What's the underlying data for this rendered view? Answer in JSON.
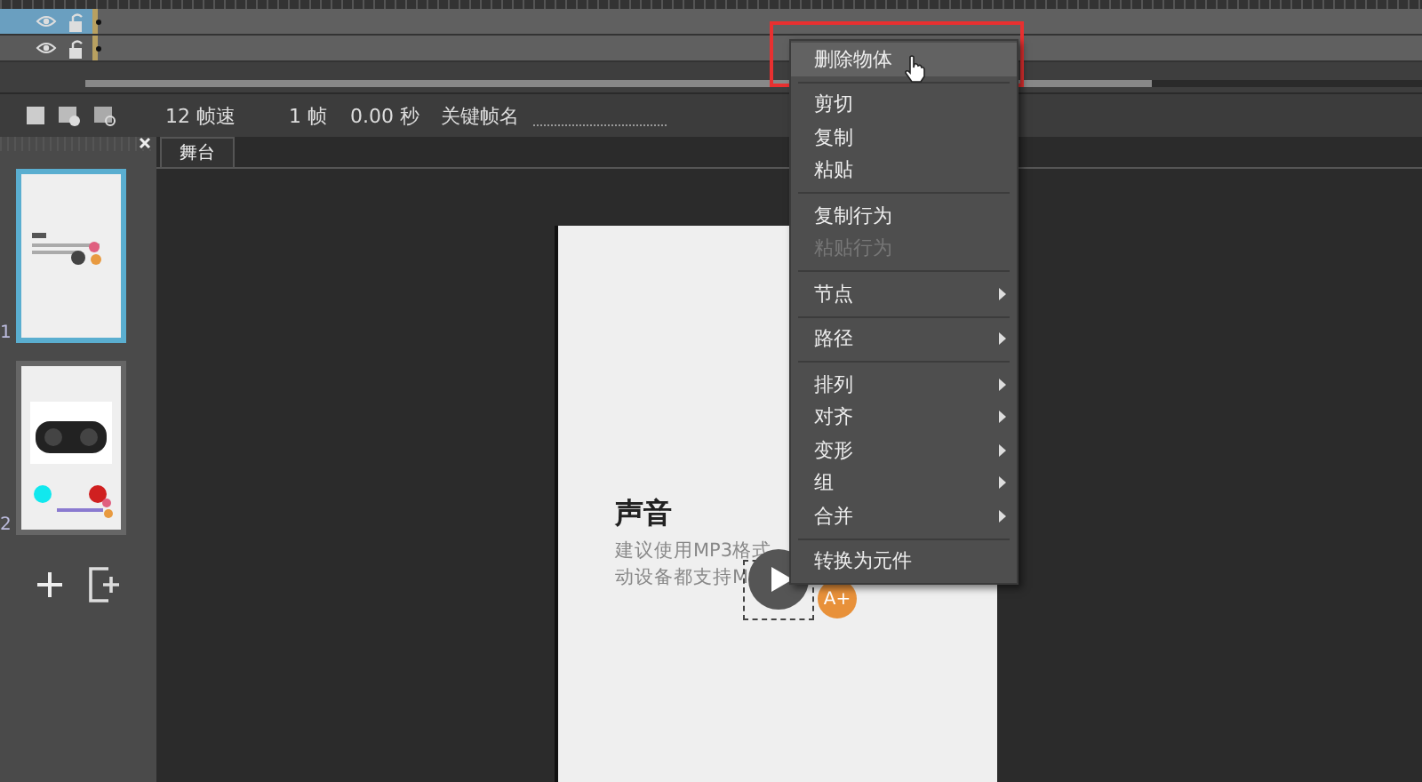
{
  "timeline": {
    "layers": [
      {
        "selected": true
      },
      {
        "selected": false
      }
    ]
  },
  "toolbar": {
    "fps": "12 帧速",
    "frame": "1 帧",
    "time": "0.00 秒",
    "keyframe_label": "关键帧名"
  },
  "slides": [
    {
      "number": "1",
      "selected": true,
      "kind": "text"
    },
    {
      "number": "2",
      "selected": false,
      "kind": "player"
    }
  ],
  "stage": {
    "tab": "舞台",
    "title": "声音",
    "lines": [
      "建议使用MP3格式",
      "动设备都支持M"
    ],
    "badge": "A+"
  },
  "context_menu": {
    "items": [
      {
        "kind": "item",
        "label": "删除物体",
        "selected": true,
        "disabled": false,
        "submenu": false
      },
      {
        "kind": "separator"
      },
      {
        "kind": "item",
        "label": "剪切",
        "selected": false,
        "disabled": false,
        "submenu": false
      },
      {
        "kind": "item",
        "label": "复制",
        "selected": false,
        "disabled": false,
        "submenu": false
      },
      {
        "kind": "item",
        "label": "粘贴",
        "selected": false,
        "disabled": false,
        "submenu": false
      },
      {
        "kind": "separator"
      },
      {
        "kind": "item",
        "label": "复制行为",
        "selected": false,
        "disabled": false,
        "submenu": false
      },
      {
        "kind": "item",
        "label": "粘贴行为",
        "selected": false,
        "disabled": true,
        "submenu": false
      },
      {
        "kind": "separator"
      },
      {
        "kind": "item",
        "label": "节点",
        "selected": false,
        "disabled": false,
        "submenu": true
      },
      {
        "kind": "separator"
      },
      {
        "kind": "item",
        "label": "路径",
        "selected": false,
        "disabled": false,
        "submenu": true
      },
      {
        "kind": "separator"
      },
      {
        "kind": "item",
        "label": "排列",
        "selected": false,
        "disabled": false,
        "submenu": true
      },
      {
        "kind": "item",
        "label": "对齐",
        "selected": false,
        "disabled": false,
        "submenu": true
      },
      {
        "kind": "item",
        "label": "变形",
        "selected": false,
        "disabled": false,
        "submenu": true
      },
      {
        "kind": "item",
        "label": "组",
        "selected": false,
        "disabled": false,
        "submenu": true
      },
      {
        "kind": "item",
        "label": "合并",
        "selected": false,
        "disabled": false,
        "submenu": true
      },
      {
        "kind": "separator"
      },
      {
        "kind": "item",
        "label": "转换为元件",
        "selected": false,
        "disabled": false,
        "submenu": false
      }
    ]
  }
}
